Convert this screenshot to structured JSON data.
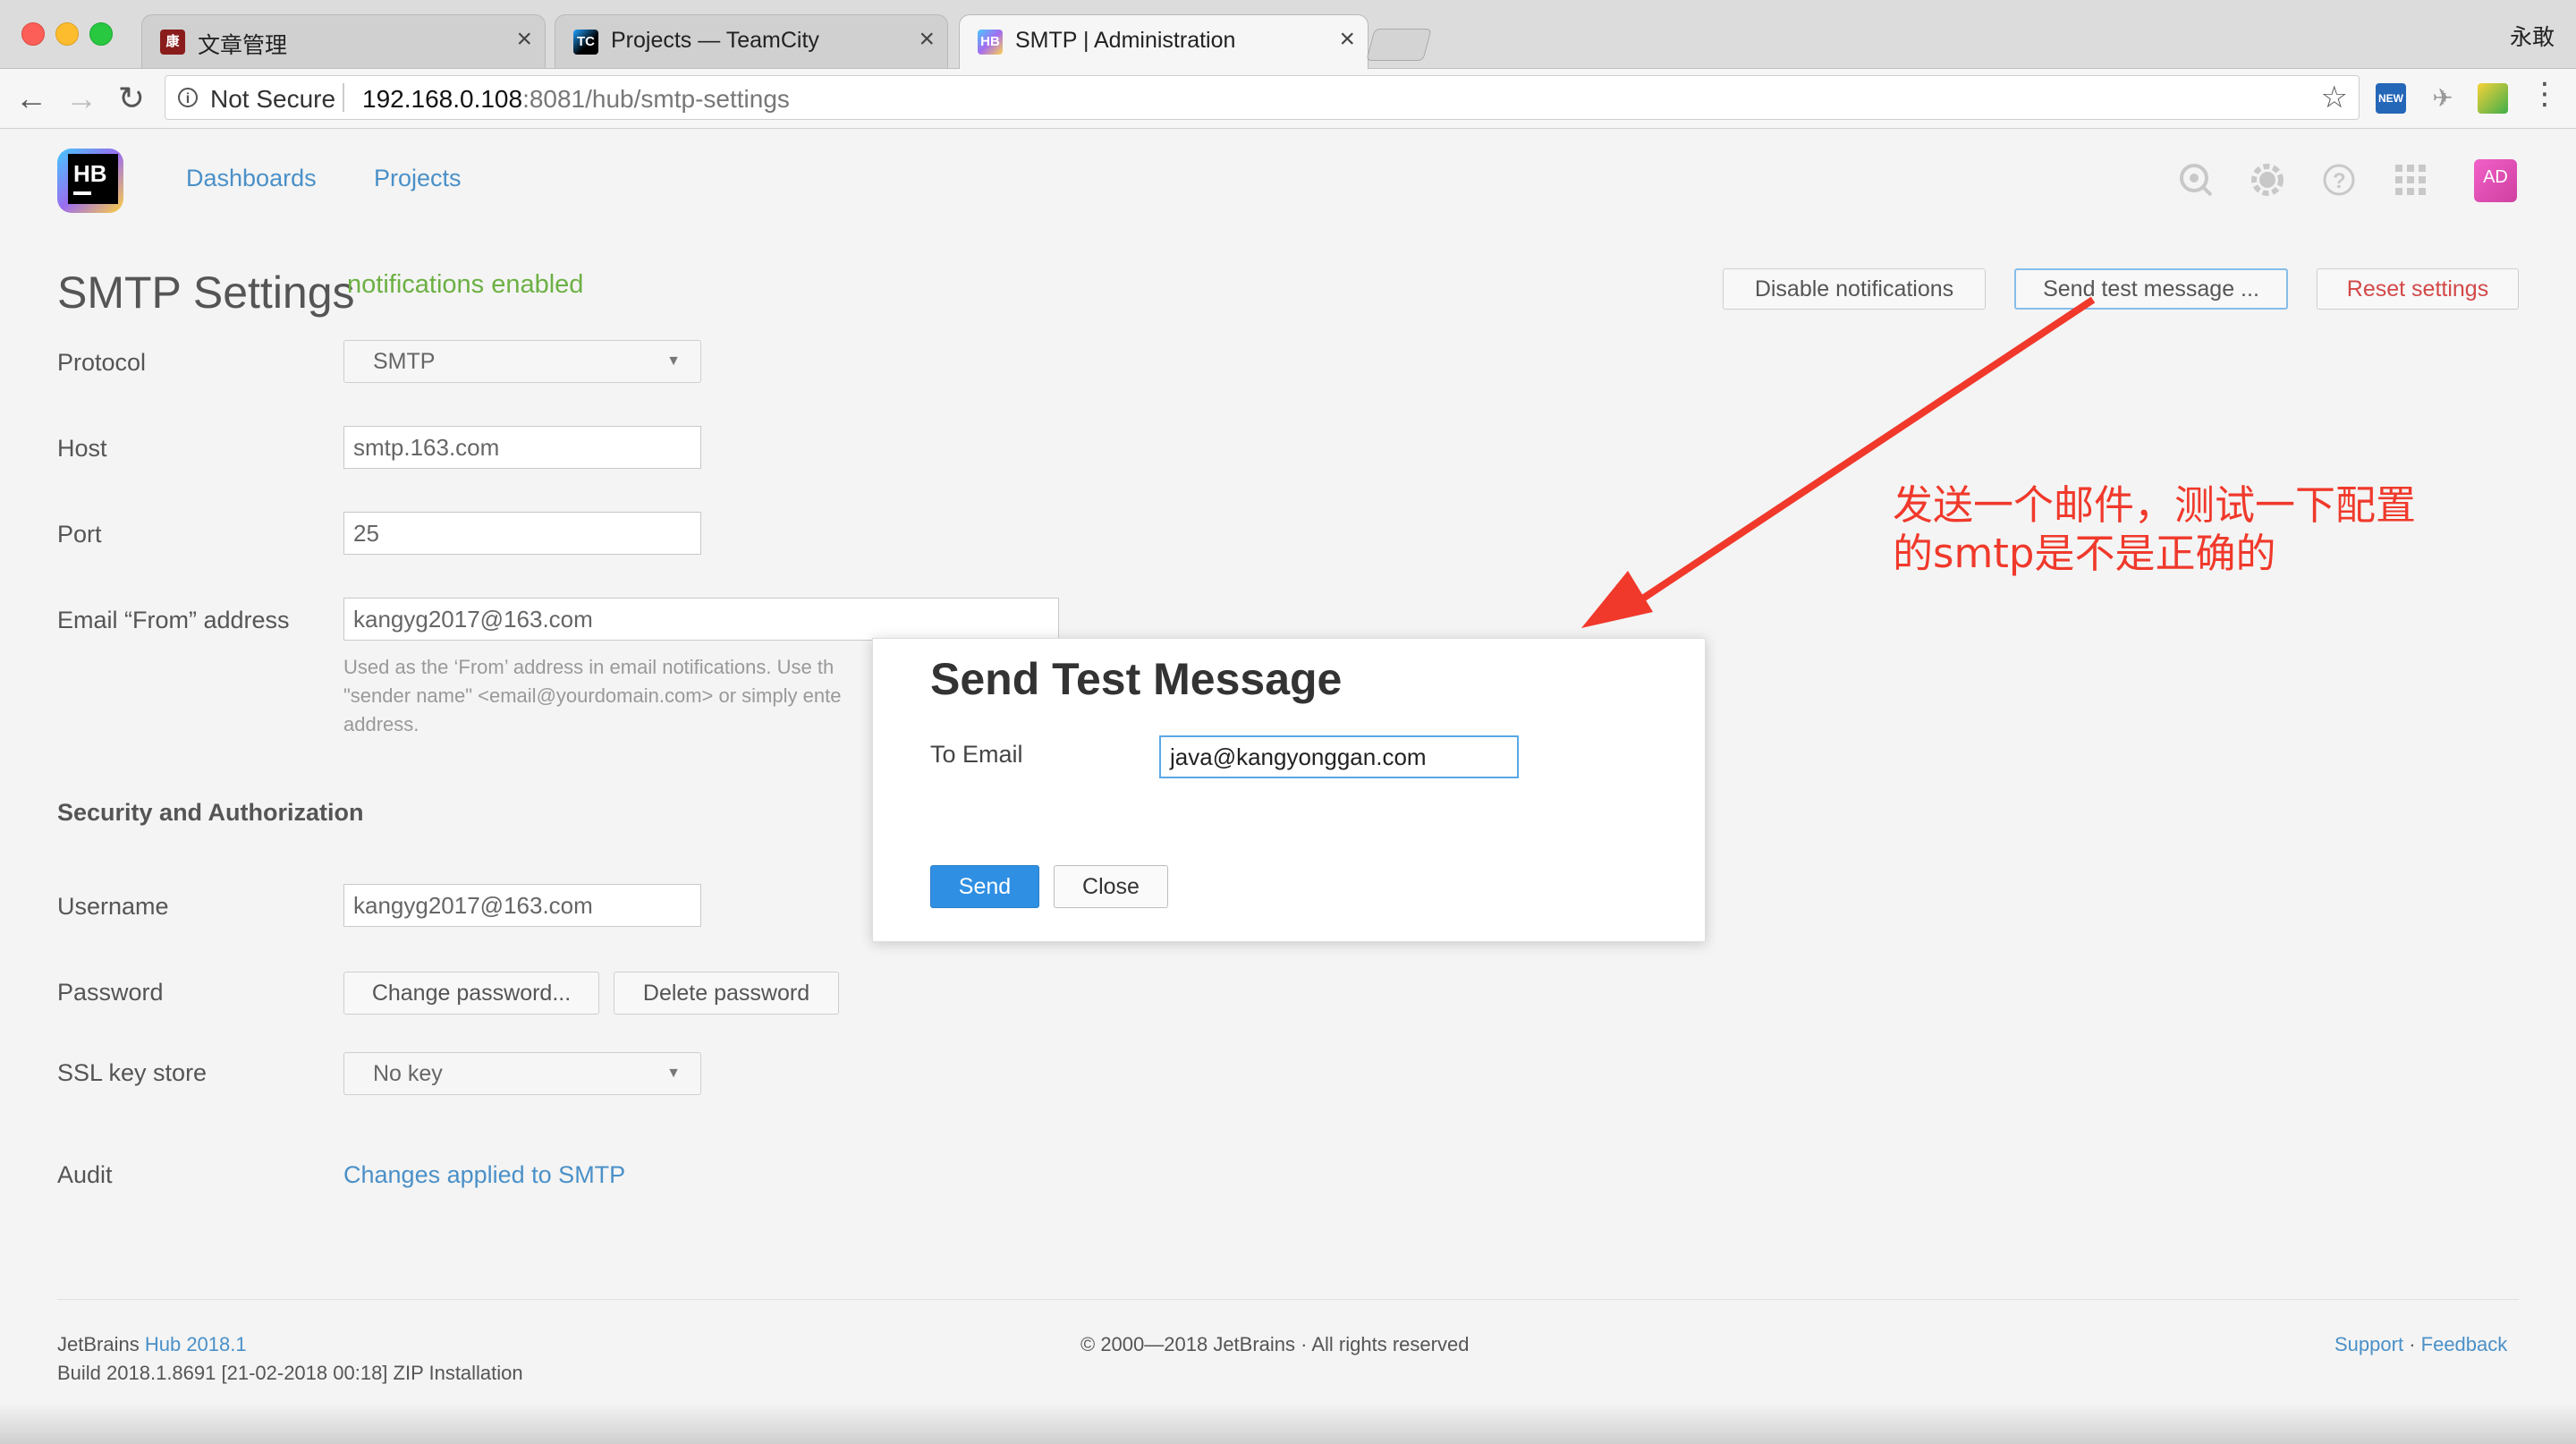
{
  "browser": {
    "tabs": [
      {
        "title": "文章管理",
        "favicon": "康"
      },
      {
        "title": "Projects — TeamCity",
        "favicon": "TC"
      },
      {
        "title": "SMTP | Administration",
        "favicon": "HB"
      }
    ],
    "profile_name": "永敢",
    "security_label": "Not Secure",
    "url_host": "192.168.0.108",
    "url_path": ":8081/hub/smtp-settings"
  },
  "hub": {
    "logo_text": "HB",
    "nav": [
      "Dashboards",
      "Projects"
    ],
    "avatar_initials": "AD"
  },
  "page": {
    "title": "SMTP Settings",
    "status": "notifications enabled",
    "actions": {
      "disable": "Disable notifications",
      "send_test": "Send test message ...",
      "reset": "Reset settings"
    },
    "fields": {
      "protocol_label": "Protocol",
      "protocol_value": "SMTP",
      "host_label": "Host",
      "host_value": "smtp.163.com",
      "port_label": "Port",
      "port_value": "25",
      "from_label": "Email “From” address",
      "from_value": "kangyg2017@163.com",
      "from_hint_1": "Used as the ‘From’ address in email notifications. Use th",
      "from_hint_2": "\"sender name\" <email@yourdomain.com> or simply ente",
      "from_hint_3": "address."
    },
    "security_section": "Security and Authorization",
    "username_label": "Username",
    "username_value": "kangyg2017@163.com",
    "password_label": "Password",
    "change_password": "Change password...",
    "delete_password": "Delete password",
    "ssl_label": "SSL key store",
    "ssl_value": "No key",
    "audit_label": "Audit",
    "audit_link": "Changes applied to SMTP"
  },
  "footer": {
    "product_prefix": "JetBrains",
    "product_link": "Hub 2018.1",
    "build": "Build 2018.1.8691 [21-02-2018 00:18] ZIP Installation",
    "copyright": "© 2000—2018 JetBrains · All rights reserved",
    "support": "Support",
    "separator": "·",
    "feedback": "Feedback"
  },
  "modal": {
    "title": "Send Test Message",
    "to_label": "To Email",
    "to_value": "java@kangyonggan.com",
    "send": "Send",
    "close": "Close"
  },
  "annotation": {
    "line1": "发送一个邮件，测试一下配置",
    "line2": "的smtp是不是正确的",
    "color": "#f0392b"
  },
  "icons": [
    "back-arrow-icon",
    "forward-arrow-icon",
    "reload-icon",
    "info-icon",
    "star-icon",
    "search-icon",
    "settings-icon",
    "help-icon",
    "apps-grid-icon"
  ]
}
